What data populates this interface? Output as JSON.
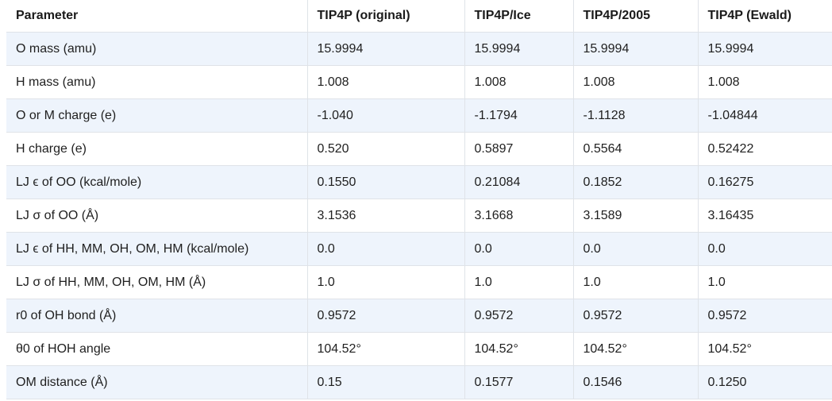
{
  "table": {
    "headers": [
      "Parameter",
      "TIP4P (original)",
      "TIP4P/Ice",
      "TIP4P/2005",
      "TIP4P (Ewald)"
    ],
    "rows": [
      {
        "param": "O mass (amu)",
        "values": [
          "15.9994",
          "15.9994",
          "15.9994",
          "15.9994"
        ]
      },
      {
        "param": "H mass (amu)",
        "values": [
          "1.008",
          "1.008",
          "1.008",
          "1.008"
        ]
      },
      {
        "param": "O or M charge (e)",
        "values": [
          "-1.040",
          "-1.1794",
          "-1.1128",
          "-1.04844"
        ]
      },
      {
        "param": "H charge (e)",
        "values": [
          "0.520",
          "0.5897",
          "0.5564",
          "0.52422"
        ]
      },
      {
        "param": "LJ ϵ of OO (kcal/mole)",
        "values": [
          "0.1550",
          "0.21084",
          "0.1852",
          "0.16275"
        ]
      },
      {
        "param": "LJ σ of OO (Å)",
        "values": [
          "3.1536",
          "3.1668",
          "3.1589",
          "3.16435"
        ]
      },
      {
        "param": "LJ ϵ of HH, MM, OH, OM, HM (kcal/mole)",
        "values": [
          "0.0",
          "0.0",
          "0.0",
          "0.0"
        ]
      },
      {
        "param": "LJ σ of HH, MM, OH, OM, HM (Å)",
        "values": [
          "1.0",
          "1.0",
          "1.0",
          "1.0"
        ]
      },
      {
        "param": "r0 of OH bond (Å)",
        "values": [
          "0.9572",
          "0.9572",
          "0.9572",
          "0.9572"
        ]
      },
      {
        "param": "θ0 of HOH angle",
        "values": [
          "104.52°",
          "104.52°",
          "104.52°",
          "104.52°"
        ]
      },
      {
        "param": "OM distance (Å)",
        "values": [
          "0.15",
          "0.1577",
          "0.1546",
          "0.1250"
        ]
      }
    ]
  }
}
